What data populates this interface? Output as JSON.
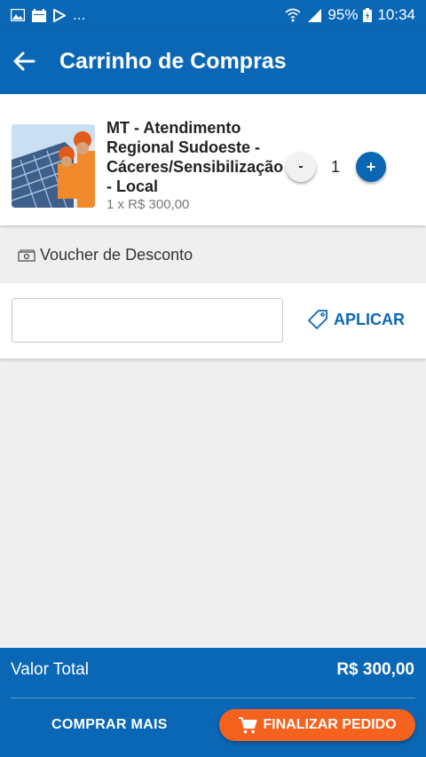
{
  "status_bar": {
    "notif_dots": "...",
    "battery": "95%",
    "time": "10:34"
  },
  "app_bar": {
    "title": "Carrinho de Compras",
    "back_icon": "arrow-left-icon"
  },
  "cart": {
    "items": [
      {
        "name": "MT - Atendimento Regional Sudoeste - Cáceres/Sensibilização - Local",
        "price_line": "1 x R$  300,00",
        "quantity": "1",
        "minus_label": "-",
        "plus_label": "+"
      }
    ]
  },
  "voucher": {
    "label": "Voucher de Desconto",
    "input_value": "",
    "apply_label": "APLICAR"
  },
  "footer": {
    "total_label": "Valor Total",
    "total_value": "R$  300,00",
    "buy_more_label": "COMPRAR MAIS",
    "finish_label": "FINALIZAR PEDIDO"
  },
  "colors": {
    "primary": "#0a67b5",
    "accent": "#f5621e",
    "background": "#efefef"
  }
}
